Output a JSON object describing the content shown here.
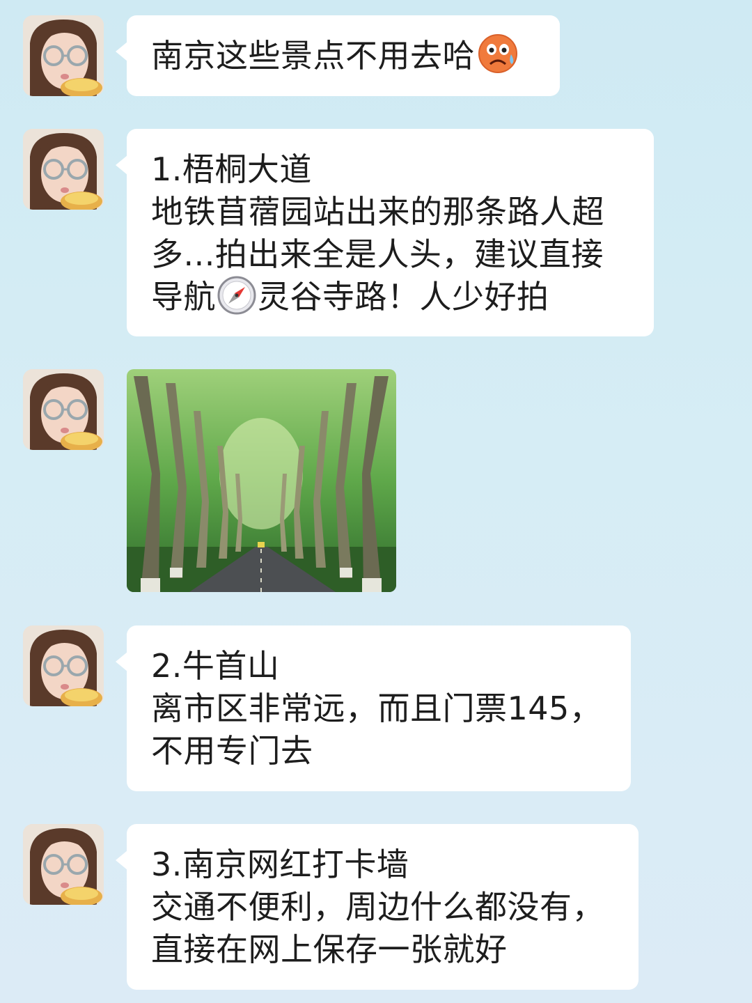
{
  "messages": [
    {
      "type": "text",
      "lines": [
        "南京这些景点不用去哈"
      ],
      "trailing_emoji": "worried-sweat-emoji"
    },
    {
      "type": "text",
      "lines": [
        "1.梧桐大道",
        "地铁苜蓿园站出来的那条路人超",
        "多...拍出来全是人头，建议直接",
        "导航",
        "灵谷寺路！人少好拍"
      ],
      "inline_emoji": "compass-emoji"
    },
    {
      "type": "image",
      "image": "tree-lined-avenue-photo"
    },
    {
      "type": "text",
      "lines": [
        "2.牛首山",
        "离市区非常远，而且门票145，",
        "不用专门去"
      ]
    },
    {
      "type": "text",
      "lines": [
        "3.南京网红打卡墙",
        "交通不便利，周边什么都没有，",
        "直接在网上保存一张就好"
      ]
    }
  ],
  "colors": {
    "background_top": "#cfeaf3",
    "background_bottom": "#dcebf6",
    "bubble": "#ffffff",
    "text": "#1d1d1d"
  }
}
